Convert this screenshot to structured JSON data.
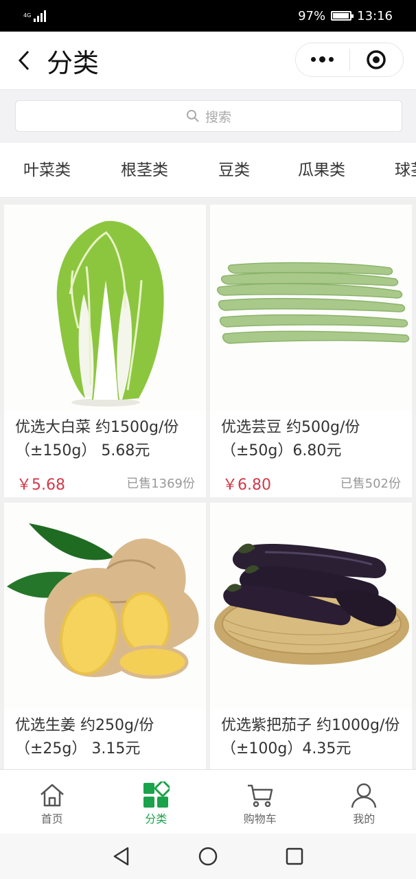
{
  "status_bar": {
    "network": "4G",
    "battery": "97%",
    "time": "13:16"
  },
  "header": {
    "title": "分类"
  },
  "search": {
    "placeholder": "搜索"
  },
  "categories": [
    "叶菜类",
    "根茎类",
    "豆类",
    "瓜果类",
    "球茎类"
  ],
  "products": [
    {
      "name": "优选大白菜 约1500g/份（±150g） 5.68元",
      "price": "￥5.68",
      "sold": "已售1369份",
      "image": "napa-cabbage"
    },
    {
      "name": "优选芸豆 约500g/份（±50g）6.80元",
      "price": "￥6.80",
      "sold": "已售502份",
      "image": "green-beans"
    },
    {
      "name": "优选生姜 约250g/份（±25g） 3.15元",
      "price": "",
      "sold": "",
      "image": "ginger"
    },
    {
      "name": "优选紫把茄子 约1000g/份（±100g）4.35元",
      "price": "",
      "sold": "",
      "image": "eggplant"
    }
  ],
  "tabbar": [
    {
      "label": "首页",
      "icon": "home-icon",
      "active": false
    },
    {
      "label": "分类",
      "icon": "category-icon",
      "active": true
    },
    {
      "label": "购物车",
      "icon": "cart-icon",
      "active": false
    },
    {
      "label": "我的",
      "icon": "user-icon",
      "active": false
    }
  ],
  "colors": {
    "accent": "#1aa34a",
    "price": "#d23a4a"
  }
}
